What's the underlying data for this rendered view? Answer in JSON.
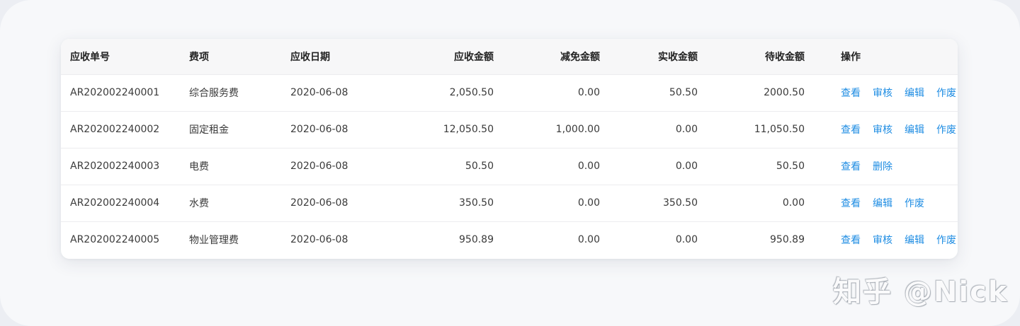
{
  "table": {
    "headers": [
      "应收单号",
      "费项",
      "应收日期",
      "应收金额",
      "减免金额",
      "实收金额",
      "待收金额",
      "操作"
    ],
    "rows": [
      {
        "id": "AR202002240001",
        "item": "综合服务费",
        "date": "2020-06-08",
        "receivable": "2,050.50",
        "reduction": "0.00",
        "received": "50.50",
        "pending": "2000.50",
        "actions": [
          "查看",
          "审核",
          "编辑",
          "作废"
        ]
      },
      {
        "id": "AR202002240002",
        "item": "固定租金",
        "date": "2020-06-08",
        "receivable": "12,050.50",
        "reduction": "1,000.00",
        "received": "0.00",
        "pending": "11,050.50",
        "actions": [
          "查看",
          "审核",
          "编辑",
          "作废"
        ]
      },
      {
        "id": "AR202002240003",
        "item": "电费",
        "date": "2020-06-08",
        "receivable": "50.50",
        "reduction": "0.00",
        "received": "0.00",
        "pending": "50.50",
        "actions": [
          "查看",
          "删除"
        ]
      },
      {
        "id": "AR202002240004",
        "item": "水费",
        "date": "2020-06-08",
        "receivable": "350.50",
        "reduction": "0.00",
        "received": "350.50",
        "pending": "0.00",
        "actions": [
          "查看",
          "编辑",
          "作废"
        ]
      },
      {
        "id": "AR202002240005",
        "item": "物业管理费",
        "date": "2020-06-08",
        "receivable": "950.89",
        "reduction": "0.00",
        "received": "0.00",
        "pending": "950.89",
        "actions": [
          "查看",
          "审核",
          "编辑",
          "作废"
        ]
      }
    ]
  },
  "watermark": "知乎 @Nick",
  "colors": {
    "link": "#1f8de3",
    "header_bg": "#f7f7f8",
    "page_bg": "#f7f8fa"
  }
}
